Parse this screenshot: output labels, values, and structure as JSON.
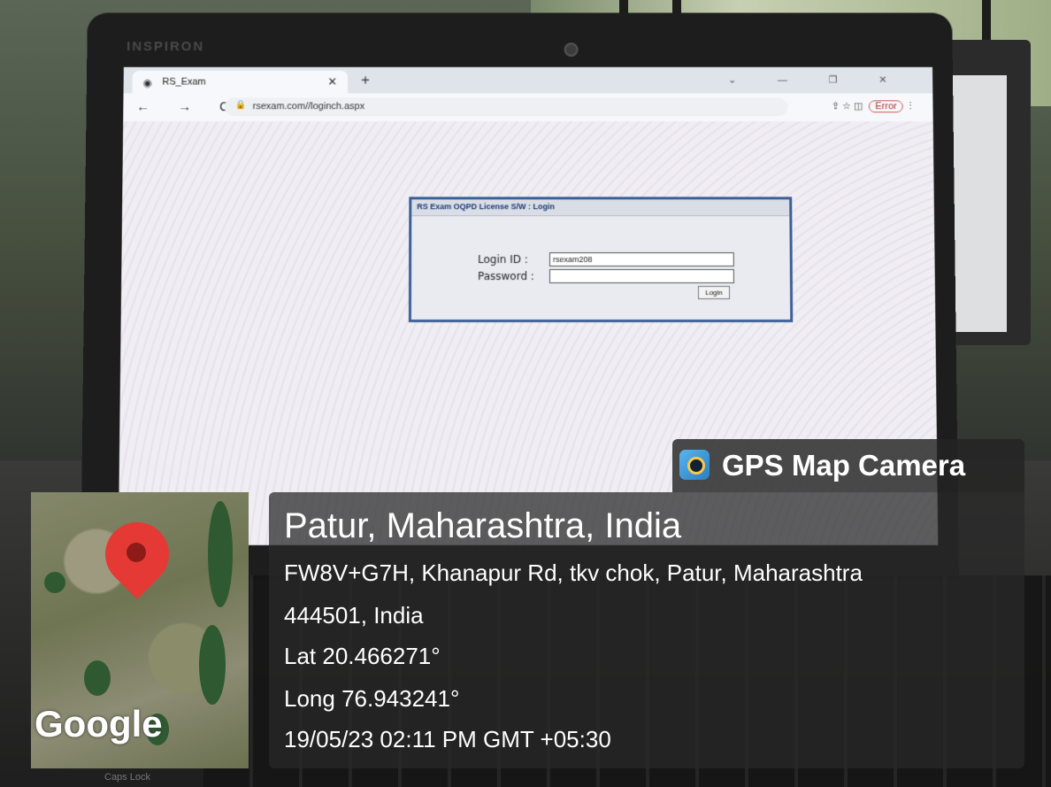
{
  "laptop": {
    "brand": "INSPIRON"
  },
  "browser": {
    "tab_title": "RS_Exam",
    "tab_close": "✕",
    "new_tab": "+",
    "nav_icons": "← → C",
    "url": "rsexam.com//loginch.aspx",
    "window_controls": "⌄ — ❐ ✕",
    "toolbar_error": "Error"
  },
  "login_form": {
    "title": "RS Exam OQPD License S/W : Login",
    "login_id_label": "Login ID :",
    "login_id_value": "rsexam208",
    "password_label": "Password :",
    "password_value": "",
    "login_button": "Login"
  },
  "gps_overlay": {
    "app_name": "GPS Map Camera",
    "place": "Patur, Maharashtra, India",
    "address_line1": "FW8V+G7H, Khanapur Rd, tkv chok, Patur, Maharashtra",
    "address_line2": "444501, India",
    "latitude": "Lat 20.466271°",
    "longitude": "Long 76.943241°",
    "datetime": "19/05/23 02:11 PM GMT +05:30",
    "map_logo": "Google"
  },
  "keyboard": {
    "caps_label": "Caps Lock"
  }
}
